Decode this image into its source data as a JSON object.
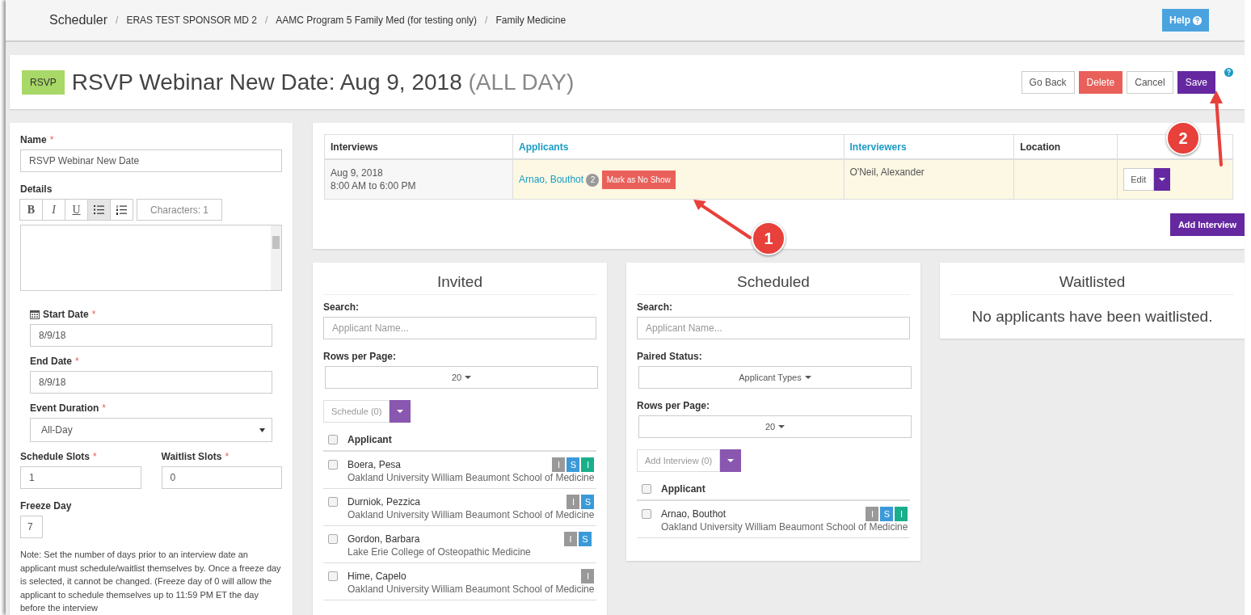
{
  "topbar": {
    "app": "Scheduler",
    "crumbs": [
      {
        "separator": "/",
        "label": "ERAS TEST SPONSOR MD 2"
      },
      {
        "separator": "/",
        "label": "AAMC Program 5 Family Med (for testing only)"
      },
      {
        "separator": "/",
        "label": "Family Medicine"
      }
    ],
    "help": "Help"
  },
  "header": {
    "badge": "RSVP",
    "title": "RSVP Webinar New Date: Aug 9, 2018",
    "suffix": "(ALL DAY)",
    "buttons": [
      {
        "label": "Go Back",
        "kind": "default"
      },
      {
        "label": "Delete",
        "kind": "danger"
      },
      {
        "label": "Cancel",
        "kind": "default"
      },
      {
        "label": "Save",
        "kind": "primary"
      }
    ]
  },
  "form": {
    "name": {
      "label": "Name",
      "mark": "*",
      "value": "RSVP Webinar New Date"
    },
    "details": {
      "label": "Details",
      "toolbar": [
        {
          "kind": "bold",
          "label": "B",
          "active": false
        },
        {
          "kind": "italic",
          "label": "I",
          "active": false
        },
        {
          "kind": "underline",
          "label": "U",
          "active": false
        },
        {
          "kind": "bullets",
          "active": true
        },
        {
          "kind": "numbers",
          "active": false
        }
      ],
      "counter": "Characters: 1"
    },
    "start_date": {
      "label": "Start Date",
      "mark": "*",
      "value": "8/9/18"
    },
    "end_date": {
      "label": "End Date",
      "mark": "*",
      "value": "8/9/18"
    },
    "event_duration": {
      "label": "Event Duration",
      "mark": "*",
      "value": "All-Day"
    },
    "schedule_slots": {
      "label": "Schedule Slots",
      "mark": "*",
      "value": "1"
    },
    "waitlist_slots": {
      "label": "Waitlist Slots",
      "mark": "*",
      "value": "0"
    },
    "freeze_day": {
      "label": "Freeze Day",
      "value": "7"
    },
    "note": "Note: Set the number of days prior to an interview date an applicant must schedule/waitlist themselves by. Once a freeze day is selected, it cannot be changed. (Freeze day of 0 will allow the applicant to schedule themselves up to 11:59 PM ET the day before the interview"
  },
  "interviews": {
    "columns": [
      {
        "label": "Interviews",
        "link": false
      },
      {
        "label": "Applicants",
        "link": true
      },
      {
        "label": "Interviewers",
        "link": true
      },
      {
        "label": "Location",
        "link": false
      }
    ],
    "rows": [
      {
        "date": "Aug 9, 2018",
        "time": "8:00 AM to 6:00 PM",
        "applicant": "Arnao, Bouthot",
        "count": "2",
        "action": "Mark as No Show",
        "interviewer": "O'Neil, Alexander",
        "edit": "Edit"
      }
    ],
    "add": "Add Interview"
  },
  "invited": {
    "title": "Invited",
    "search_label": "Search:",
    "search_placeholder": "Applicant Name...",
    "rows_label": "Rows per Page:",
    "rows_value": "20",
    "action": "Schedule (0)",
    "column": "Applicant",
    "all_checked": false,
    "applicants": [
      {
        "name": "Boera, Pesa",
        "school": "Oakland University William Beaumont School of Medicine",
        "checked": false,
        "tags": [
          {
            "label": "I",
            "color": "#999999"
          },
          {
            "label": "S",
            "color": "#3a9ad9"
          },
          {
            "label": "I",
            "color": "#1aaf8b"
          }
        ]
      },
      {
        "name": "Durniok, Pezzica",
        "school": "Oakland University William Beaumont School of Medicine",
        "checked": false,
        "tags": [
          {
            "label": "I",
            "color": "#999999"
          },
          {
            "label": "S",
            "color": "#3a9ad9"
          }
        ]
      },
      {
        "name": "Gordon, Barbara",
        "school": "Lake Erie College of Osteopathic Medicine",
        "checked": false,
        "tags": [
          {
            "label": "I",
            "color": "#999999"
          },
          {
            "label": "S",
            "color": "#3a9ad9"
          }
        ]
      },
      {
        "name": "Hime, Capelo",
        "school": "Oakland University William Beaumont School of Medicine",
        "checked": false,
        "tags": [
          {
            "label": "I",
            "color": "#999999"
          }
        ]
      }
    ]
  },
  "scheduled": {
    "title": "Scheduled",
    "search_label": "Search:",
    "search_placeholder": "Applicant Name...",
    "paired_label": "Paired Status:",
    "paired_value": "Applicant Types",
    "rows_label": "Rows per Page:",
    "rows_value": "20",
    "action": "Add Interview (0)",
    "column": "Applicant",
    "all_checked": false,
    "applicants": [
      {
        "name": "Arnao, Bouthot",
        "school": "Oakland University William Beaumont School of Medicine",
        "checked": false,
        "tags": [
          {
            "label": "I",
            "color": "#999999"
          },
          {
            "label": "S",
            "color": "#3a9ad9"
          },
          {
            "label": "I",
            "color": "#1aaf8b"
          }
        ]
      }
    ]
  },
  "waitlisted": {
    "title": "Waitlisted",
    "empty": "No applicants have been waitlisted."
  },
  "annotations": [
    {
      "number": "1"
    },
    {
      "number": "2"
    }
  ]
}
